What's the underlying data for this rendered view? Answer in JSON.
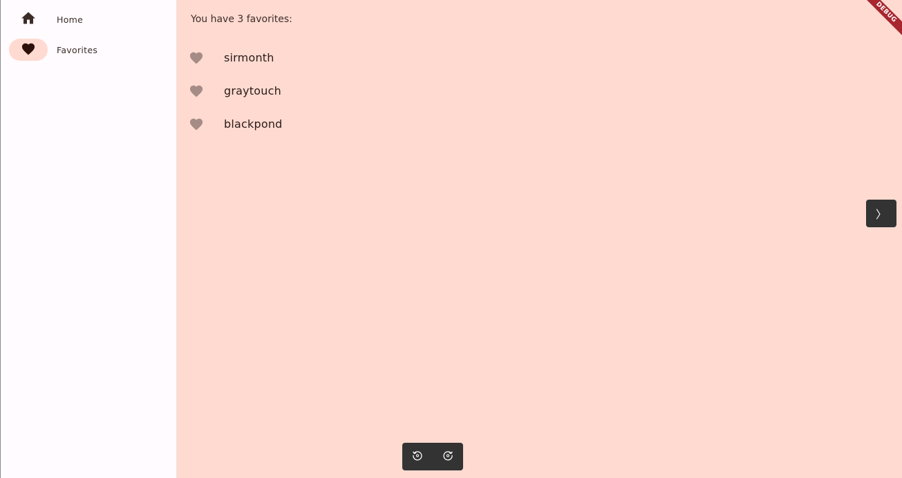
{
  "nav": {
    "items": [
      {
        "label": "Home",
        "icon": "home-icon",
        "selected": false
      },
      {
        "label": "Favorites",
        "icon": "heart-icon",
        "selected": true
      }
    ]
  },
  "main": {
    "summary": "You have 3 favorites:",
    "favorites": [
      {
        "text": "sirmonth"
      },
      {
        "text": "graytouch"
      },
      {
        "text": "blackpond"
      }
    ]
  },
  "debug_banner": {
    "label": "DEBUG"
  },
  "side_toggle": {
    "glyph": "〉"
  },
  "colors": {
    "main_background": "#ffdad1",
    "nav_background": "#fffbff",
    "selected_indicator": "#ffdad0",
    "heart_muted": "#a58c86",
    "heart_dark": "#2d100a",
    "toolbar": "#333333",
    "debug_ribbon": "#a7262f"
  }
}
